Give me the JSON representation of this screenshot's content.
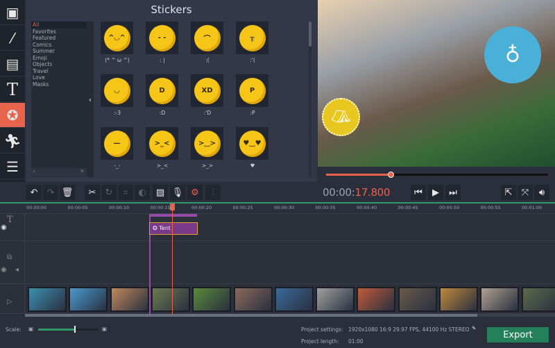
{
  "sidebar": {
    "items": [
      {
        "name": "import",
        "icon": "film-play-icon"
      },
      {
        "name": "filters",
        "icon": "magic-wand-icon"
      },
      {
        "name": "transitions",
        "icon": "transition-icon"
      },
      {
        "name": "titles",
        "icon": "text-icon"
      },
      {
        "name": "stickers",
        "icon": "sticker-icon",
        "active": true
      },
      {
        "name": "animation",
        "icon": "running-man-icon"
      },
      {
        "name": "more",
        "icon": "list-icon"
      }
    ]
  },
  "stickers": {
    "title": "Stickers",
    "categories": [
      "All",
      "Favorites",
      "Featured",
      "Comics",
      "Summer",
      "Emoji",
      "Objects",
      "Travel",
      "Love",
      "Masks"
    ],
    "items": [
      {
        "label": "(* ^ ω ^)",
        "face": "^◡^"
      },
      {
        "label": ": |",
        "face": "- -"
      },
      {
        "label": ":(",
        "face": "⌒"
      },
      {
        "label": ":'(",
        "face": "╥"
      },
      {
        "label": ":-3",
        "face": "◡"
      },
      {
        "label": ":D",
        "face": "D"
      },
      {
        "label": ":'D",
        "face": "XD"
      },
      {
        "label": ":P",
        "face": "P"
      },
      {
        "label": "-_-",
        "face": "—"
      },
      {
        "label": ">_<",
        "face": ">_<"
      },
      {
        "label": ">_>",
        "face": ">‿>"
      },
      {
        "label": "♥",
        "face": "♥‿♥"
      }
    ]
  },
  "preview": {
    "progress": 0.29
  },
  "toolbar": {
    "time_prefix": "00:00:",
    "time_value": "17.800"
  },
  "ruler": [
    "00:00:00",
    "00:00:05",
    "00:00:10",
    "00:00:15",
    "00:00:20",
    "00:00:25",
    "00:00:30",
    "00:00:35",
    "00:00:40",
    "00:00:45",
    "00:00:50",
    "00:00:55",
    "00:01:00"
  ],
  "timeline": {
    "clip_label": "Tent"
  },
  "thumbs": [
    "#3d8fb0",
    "#4a9ad0",
    "#c0885a",
    "#6a7a50",
    "#5a8a3a",
    "#8a6a5a",
    "#3a6a9a",
    "#a0a0a0",
    "#c05a3a",
    "#6a5a4a",
    "#c08a3a",
    "#b0a090",
    "#5a6a4a"
  ],
  "bottom": {
    "scale_label": "Scale:",
    "scale_value": 0.6,
    "settings_label": "Project settings:",
    "settings_value": "1920x1080 16:9 29.97 FPS, 44100 Hz STEREO",
    "length_label": "Project length:",
    "length_value": "01:00",
    "export": "Export"
  },
  "colors": {
    "accent": "#e8644c",
    "green": "#23805a"
  }
}
